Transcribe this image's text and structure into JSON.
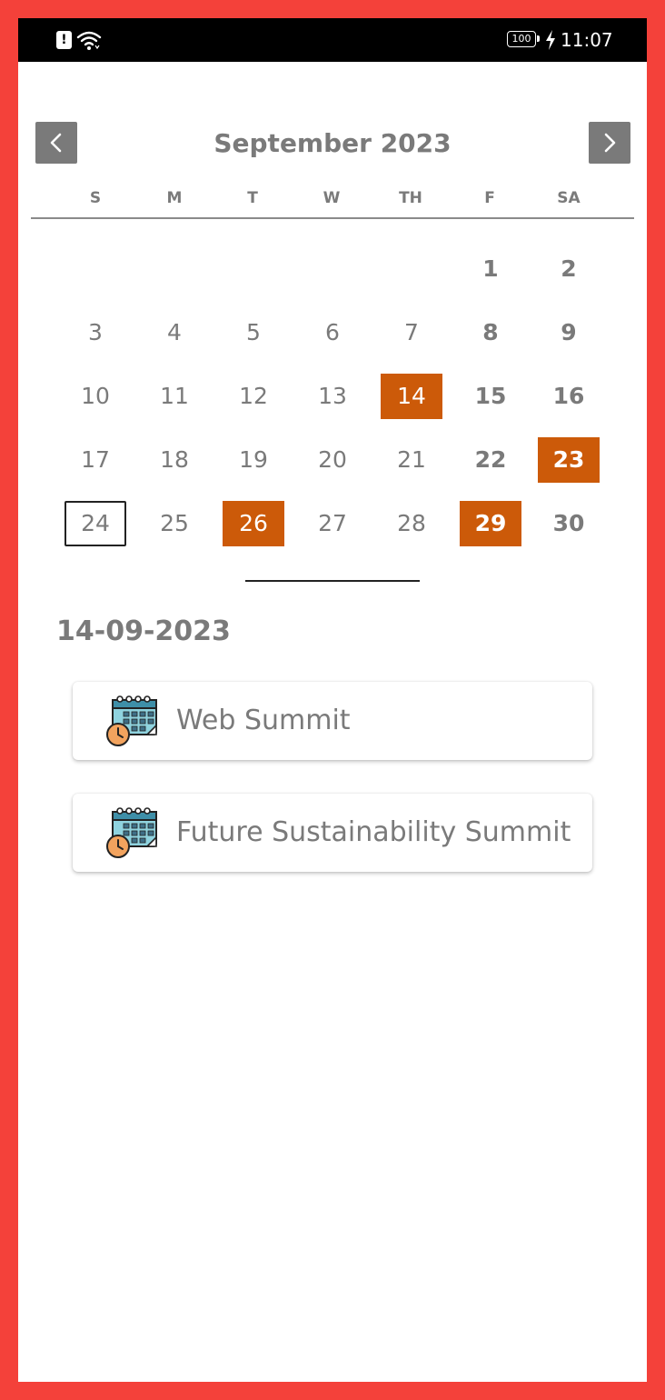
{
  "status_bar": {
    "battery": "100",
    "time": "11:07"
  },
  "calendar": {
    "month_title": "September 2023",
    "weekdays": [
      "S",
      "M",
      "T",
      "W",
      "TH",
      "F",
      "SA"
    ],
    "days": [
      {
        "label": "1",
        "weekend": true
      },
      {
        "label": "2",
        "weekend": true
      },
      {
        "label": "3"
      },
      {
        "label": "4"
      },
      {
        "label": "5"
      },
      {
        "label": "6"
      },
      {
        "label": "7"
      },
      {
        "label": "8",
        "weekend": true
      },
      {
        "label": "9",
        "weekend": true
      },
      {
        "label": "10"
      },
      {
        "label": "11"
      },
      {
        "label": "12"
      },
      {
        "label": "13"
      },
      {
        "label": "14",
        "event": true
      },
      {
        "label": "15",
        "weekend": true
      },
      {
        "label": "16",
        "weekend": true
      },
      {
        "label": "17"
      },
      {
        "label": "18"
      },
      {
        "label": "19"
      },
      {
        "label": "20"
      },
      {
        "label": "21"
      },
      {
        "label": "22",
        "weekend": true
      },
      {
        "label": "23",
        "weekend": true,
        "event": true
      },
      {
        "label": "24",
        "today": true
      },
      {
        "label": "25"
      },
      {
        "label": "26",
        "event": true
      },
      {
        "label": "27"
      },
      {
        "label": "28"
      },
      {
        "label": "29",
        "weekend": true,
        "event": true
      },
      {
        "label": "30",
        "weekend": true
      }
    ],
    "first_weekday_index": 5
  },
  "selected": {
    "date": "14-09-2023"
  },
  "events": [
    {
      "title": "Web Summit",
      "icon": "calendar-clock-icon"
    },
    {
      "title": "Future Sustainability Summit",
      "icon": "calendar-clock-icon"
    }
  ],
  "colors": {
    "event_highlight": "#CC5A09",
    "text_gray": "#7A7A7A",
    "frame": "#F4413A"
  }
}
